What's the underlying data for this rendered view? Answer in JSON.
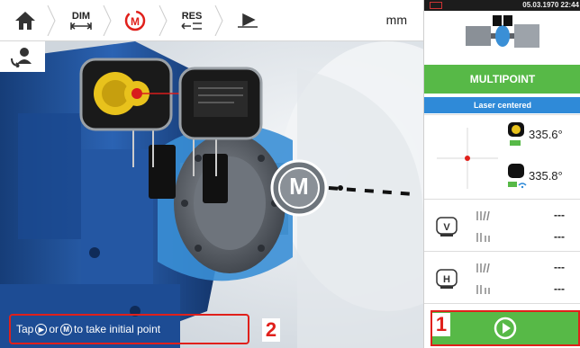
{
  "toolbar": {
    "home_icon": "home-icon",
    "dim_label": "DIM",
    "measure_icon": "measure-icon",
    "res_label": "RES",
    "align_icon": "align-icon",
    "units": "mm",
    "machine_view_icon": "machine-view-icon"
  },
  "scene": {
    "m_button_label": "M"
  },
  "hint": {
    "prefix": "Tap",
    "play_glyph": "▶",
    "or": "or",
    "m_glyph": "M",
    "suffix": "to take initial point"
  },
  "callouts": {
    "one": "1",
    "two": "2"
  },
  "panel": {
    "status_time": "05.03.1970 22:44",
    "mode": "MULTIPOINT",
    "laser_status": "Laser centered",
    "sensor1_angle": "335.6°",
    "sensor2_angle": "335.8°",
    "vertical_label": "V",
    "horizontal_label": "H",
    "v_offset": "---",
    "v_angularity": "---",
    "h_offset": "---",
    "h_angularity": "---"
  },
  "colors": {
    "accent_green": "#57b947",
    "laser_blue": "#2f8ad8",
    "callout_red": "#e0201b",
    "coupling_blue": "#3a8fd6",
    "machine_blue": "#1e4f96"
  }
}
